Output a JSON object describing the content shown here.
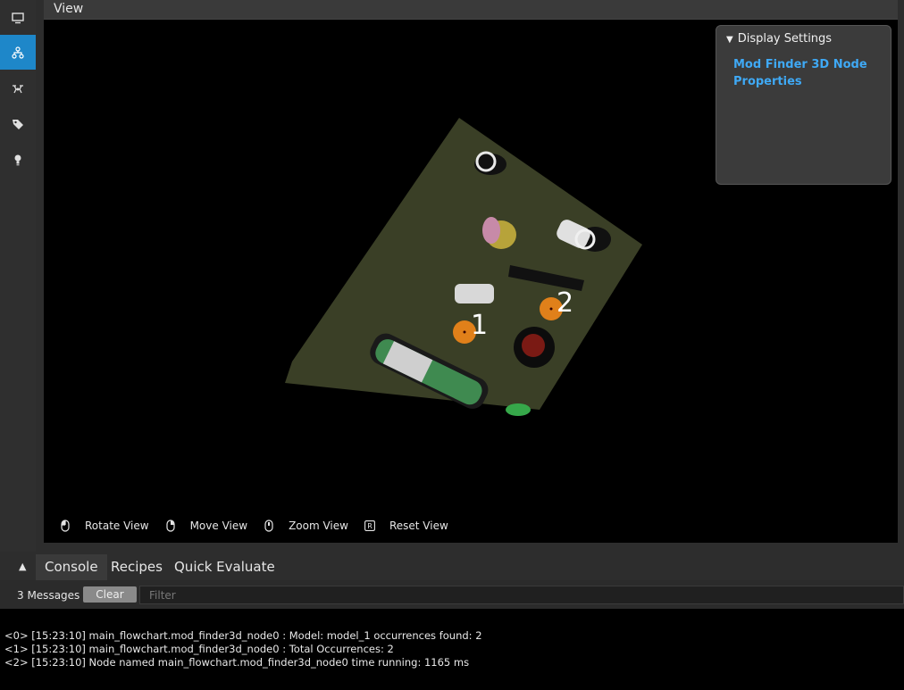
{
  "sidebar": {
    "items": [
      {
        "name": "monitor-icon",
        "active": false
      },
      {
        "name": "flowchart-icon",
        "active": true
      },
      {
        "name": "drone-icon",
        "active": false
      },
      {
        "name": "tag-icon",
        "active": false
      },
      {
        "name": "lightbulb-icon",
        "active": false
      }
    ]
  },
  "view": {
    "title": "View",
    "occurrence_labels": [
      "1",
      "2"
    ],
    "display_settings": {
      "header": "Display Settings",
      "link": "Mod Finder 3D Node Properties"
    },
    "controls": [
      {
        "icon": "mouse-left-icon",
        "label": "Rotate View"
      },
      {
        "icon": "mouse-right-icon",
        "label": "Move View"
      },
      {
        "icon": "mouse-wheel-icon",
        "label": "Zoom View"
      },
      {
        "icon": "key-r-icon",
        "key": "R",
        "label": "Reset View"
      }
    ]
  },
  "bottom_panel": {
    "collapse_glyph": "▲",
    "tabs": [
      {
        "label": "Console",
        "active": true
      },
      {
        "label": "Recipes",
        "active": false
      },
      {
        "label": "Quick Evaluate",
        "active": false
      }
    ],
    "message_count": "3 Messages",
    "clear_label": "Clear",
    "filter_placeholder": "Filter",
    "log": [
      "<0> [15:23:10] main_flowchart.mod_finder3d_node0 : Model: model_1 occurrences found: 2",
      "<1> [15:23:10] main_flowchart.mod_finder3d_node0 : Total Occurrences: 2",
      "<2> [15:23:10] Node named main_flowchart.mod_finder3d_node0 time running: 1165 ms"
    ]
  },
  "colors": {
    "accent": "#1e87c9",
    "link": "#3fa9f5",
    "tray": "#3a3f26"
  }
}
